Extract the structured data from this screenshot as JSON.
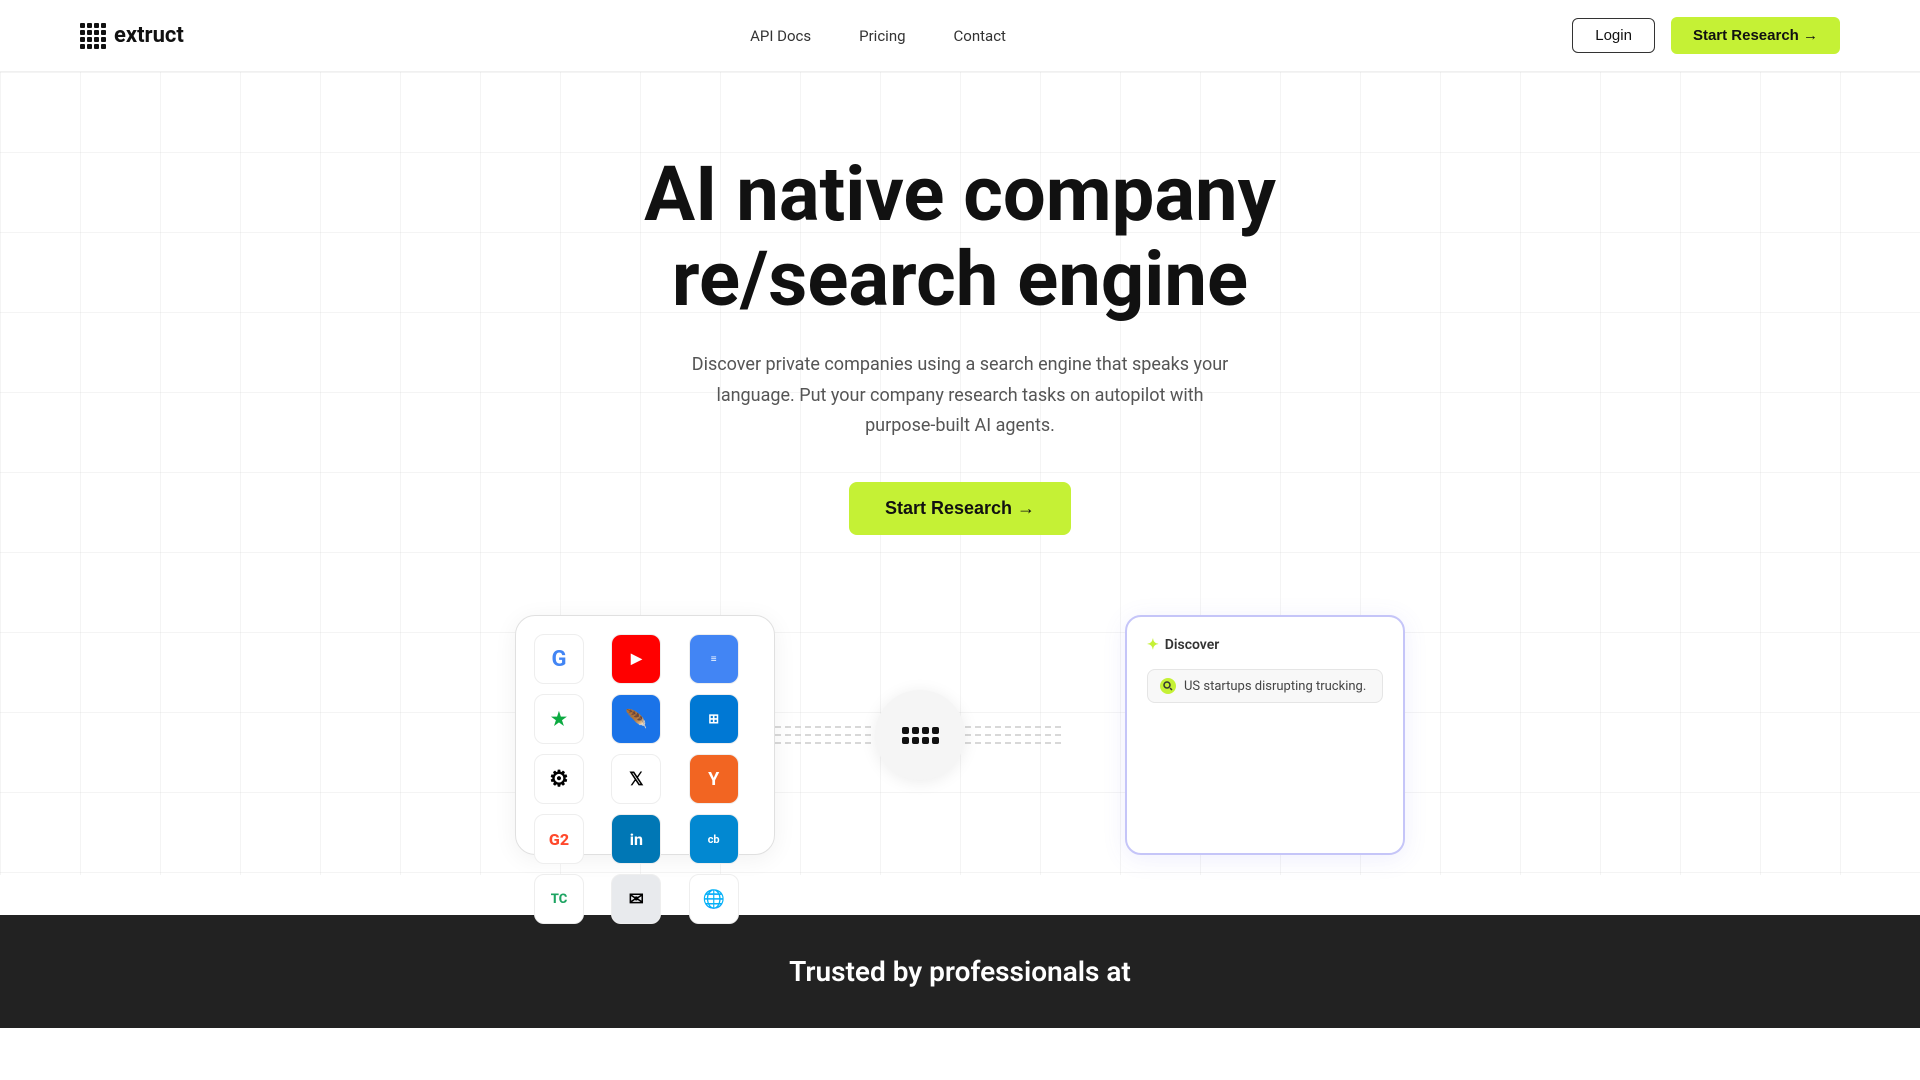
{
  "brand": {
    "name": "extruct",
    "logo_alt": "extruct logo"
  },
  "nav": {
    "links": [
      {
        "id": "api-docs",
        "label": "API Docs"
      },
      {
        "id": "pricing",
        "label": "Pricing"
      },
      {
        "id": "contact",
        "label": "Contact"
      }
    ],
    "login_label": "Login",
    "start_research_label": "Start Research →"
  },
  "hero": {
    "headline_line1": "AI native company",
    "headline_line2": "re/search engine",
    "subtext": "Discover private companies using a search engine that speaks your language. Put your company research tasks on autopilot with purpose-built AI agents.",
    "cta_label": "Start Research →"
  },
  "discover_card": {
    "header": "✦ Discover",
    "search_query": "US startups disrupting trucking."
  },
  "trusted_section": {
    "label": "Trusted by professionals at"
  },
  "colors": {
    "accent": "#c5f135",
    "dark": "#111111",
    "nav_border": "#f0f0f0"
  }
}
